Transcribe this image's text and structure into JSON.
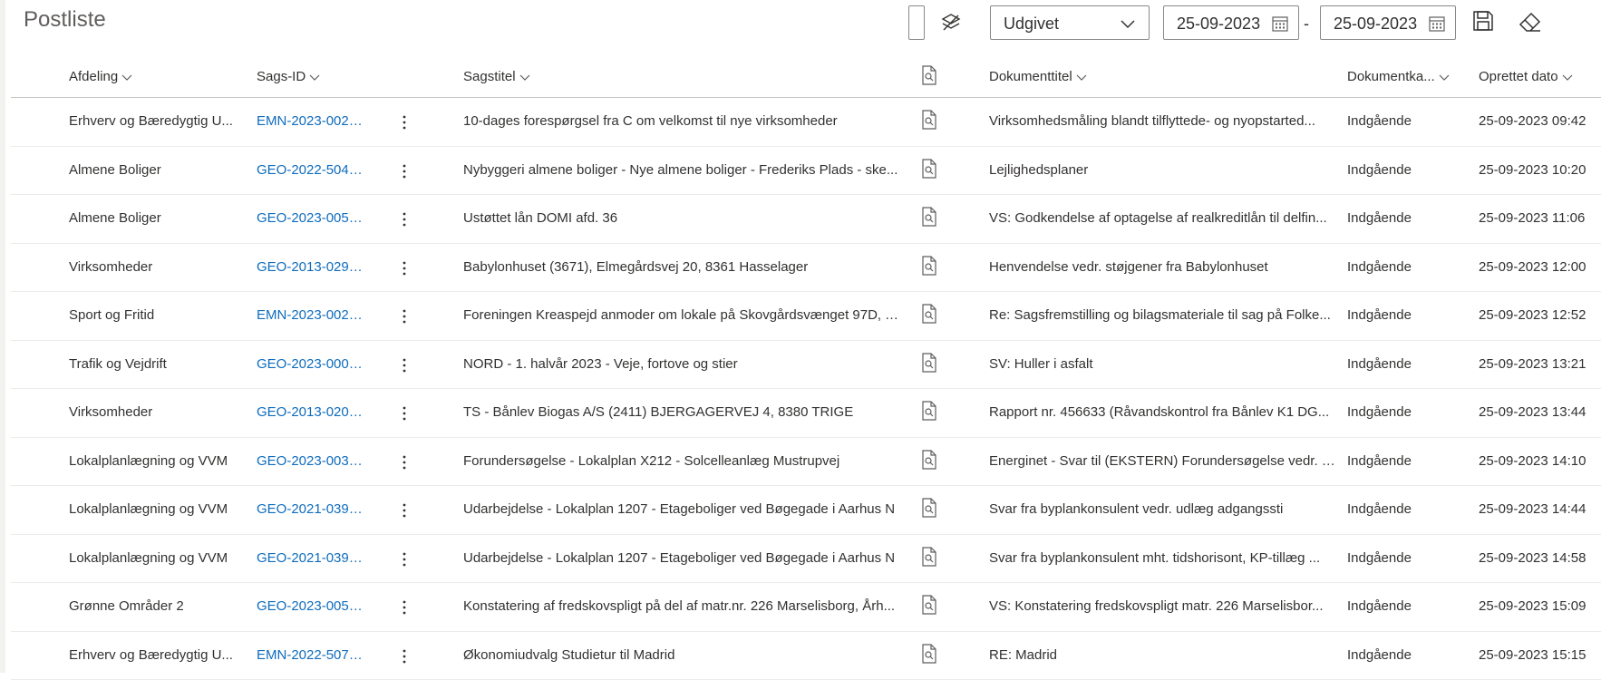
{
  "page": {
    "title": "Postliste"
  },
  "toolbar": {
    "status_value": "Udgivet",
    "date_from": "25-09-2023",
    "date_separator": "-",
    "date_to": "25-09-2023"
  },
  "columns": {
    "afdeling": "Afdeling",
    "sags_id": "Sags-ID",
    "sagstitel": "Sagstitel",
    "dokumenttitel": "Dokumenttitel",
    "dokumentkategori": "Dokumentka...",
    "oprettet": "Oprettet dato"
  },
  "rows": [
    {
      "afdeling": "Erhverv og Bæredygtig U...",
      "sags_id": "EMN-2023-0021...",
      "sagstitel": "10-dages forespørgsel fra C om velkomst til nye virksomheder",
      "dokumenttitel": "Virksomhedsmåling blandt tilflyttede- og nyopstarted...",
      "kategori": "Indgående",
      "dato": "25-09-2023 09:42"
    },
    {
      "afdeling": "Almene Boliger",
      "sags_id": "GEO-2022-5041...",
      "sagstitel": "Nybyggeri almene boliger - Nye almene boliger - Frederiks Plads - ske...",
      "dokumenttitel": "Lejlighedsplaner",
      "kategori": "Indgående",
      "dato": "25-09-2023 10:20"
    },
    {
      "afdeling": "Almene Boliger",
      "sags_id": "GEO-2023-0051...",
      "sagstitel": "Ustøttet lån DOMI afd. 36",
      "dokumenttitel": "VS: Godkendelse af optagelse af realkreditlån til delfin...",
      "kategori": "Indgående",
      "dato": "25-09-2023 11:06"
    },
    {
      "afdeling": "Virksomheder",
      "sags_id": "GEO-2013-0296...",
      "sagstitel": "Babylonhuset (3671), Elmegårdsvej 20, 8361 Hasselager",
      "dokumenttitel": "Henvendelse vedr. støjgener fra Babylonhuset",
      "kategori": "Indgående",
      "dato": "25-09-2023 12:00"
    },
    {
      "afdeling": "Sport og Fritid",
      "sags_id": "EMN-2023-0021...",
      "sagstitel": "Foreningen Kreaspejd anmoder om lokale på Skovgårdsvænget 97D, T...",
      "dokumenttitel": "Re: Sagsfremstilling og bilagsmateriale til sag på Folke...",
      "kategori": "Indgående",
      "dato": "25-09-2023 12:52"
    },
    {
      "afdeling": "Trafik og Vejdrift",
      "sags_id": "GEO-2023-0000...",
      "sagstitel": "NORD - 1. halvår 2023 - Veje, fortove og stier",
      "dokumenttitel": "SV: Huller i asfalt",
      "kategori": "Indgående",
      "dato": "25-09-2023 13:21"
    },
    {
      "afdeling": "Virksomheder",
      "sags_id": "GEO-2013-0209...",
      "sagstitel": "TS - Bånlev Biogas A/S (2411) BJERGAGERVEJ 4, 8380 TRIGE",
      "dokumenttitel": "Rapport nr. 456633 (Råvandskontrol fra Bånlev K1 DG...",
      "kategori": "Indgående",
      "dato": "25-09-2023 13:44"
    },
    {
      "afdeling": "Lokalplanlægning og VVM",
      "sags_id": "GEO-2023-0035...",
      "sagstitel": "Forundersøgelse - Lokalplan X212 - Solcelleanlæg Mustrupvej",
      "dokumenttitel": "Energinet - Svar til (EKSTERN) Forundersøgelse vedr. I...",
      "kategori": "Indgående",
      "dato": "25-09-2023 14:10"
    },
    {
      "afdeling": "Lokalplanlægning og VVM",
      "sags_id": "GEO-2021-0399...",
      "sagstitel": "Udarbejdelse - Lokalplan 1207 - Etageboliger ved Bøgegade i Aarhus N",
      "dokumenttitel": "Svar fra byplankonsulent vedr. udlæg adgangssti",
      "kategori": "Indgående",
      "dato": "25-09-2023 14:44"
    },
    {
      "afdeling": "Lokalplanlægning og VVM",
      "sags_id": "GEO-2021-0399...",
      "sagstitel": "Udarbejdelse - Lokalplan 1207 - Etageboliger ved Bøgegade i Aarhus N",
      "dokumenttitel": "Svar fra byplankonsulent mht. tidshorisont, KP-tillæg ...",
      "kategori": "Indgående",
      "dato": "25-09-2023 14:58"
    },
    {
      "afdeling": "Grønne Områder 2",
      "sags_id": "GEO-2023-0051...",
      "sagstitel": "Konstatering af fredskovspligt på del af matr.nr. 226 Marselisborg, Årh...",
      "dokumenttitel": "VS: Konstatering fredskovspligt matr. 226 Marselisbor...",
      "kategori": "Indgående",
      "dato": "25-09-2023 15:09"
    },
    {
      "afdeling": "Erhverv og Bæredygtig U...",
      "sags_id": "EMN-2022-5075...",
      "sagstitel": "Økonomiudvalg Studietur til Madrid",
      "dokumenttitel": "RE: Madrid",
      "kategori": "Indgående",
      "dato": "25-09-2023 15:15"
    }
  ]
}
